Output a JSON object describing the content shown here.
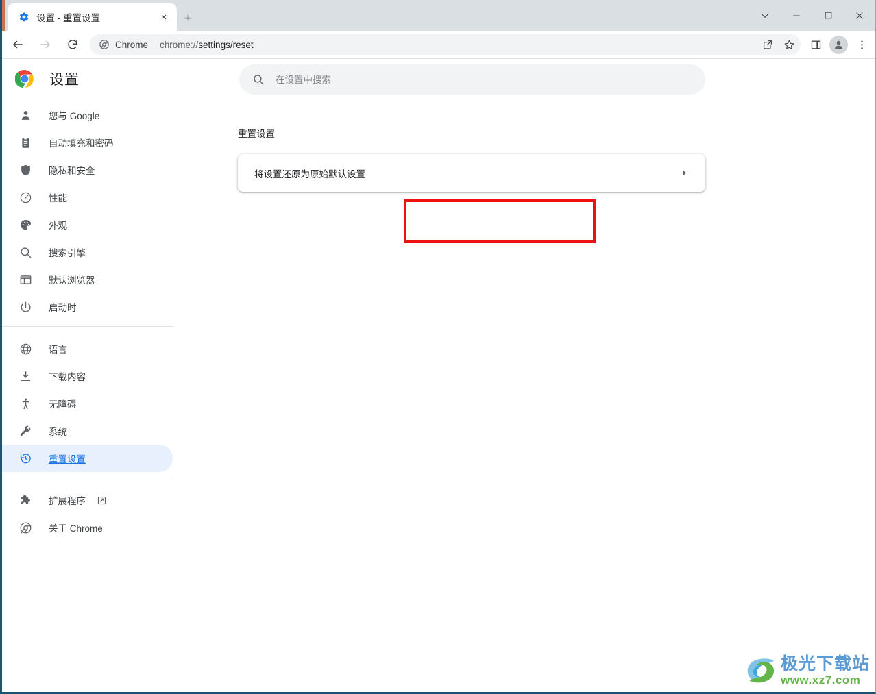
{
  "window": {
    "controls": [
      {
        "name": "tab-search-button",
        "glyph": "chevron-down"
      },
      {
        "name": "minimize-button",
        "glyph": "minimize"
      },
      {
        "name": "maximize-button",
        "glyph": "maximize"
      },
      {
        "name": "close-button",
        "glyph": "close"
      }
    ]
  },
  "tabstrip": {
    "tab_title": "设置 - 重置设置",
    "favicon": "settings-gear-icon",
    "close_label": "×",
    "new_tab_label": "+"
  },
  "toolbar": {
    "back_label": "back-arrow-icon",
    "forward_label": "forward-arrow-icon",
    "reload_label": "reload-icon",
    "omnibox": {
      "chip_icon": "chrome-icon",
      "chip_name": "Chrome",
      "url_prefix": "chrome://",
      "url_bold": "settings/reset",
      "share_icon": "share-icon",
      "bookmark_icon": "star-icon"
    },
    "side_panel_icon": "side-panel-icon",
    "avatar_icon": "profile-avatar-icon",
    "menu_icon": "three-dot-menu-icon"
  },
  "settings": {
    "logo": "chrome-logo",
    "title": "设置",
    "search": {
      "icon": "search-icon",
      "placeholder": "在设置中搜索",
      "value": ""
    },
    "nav_groups": [
      {
        "items": [
          {
            "icon": "person-icon",
            "label": "您与 Google",
            "selected": false,
            "external": false
          },
          {
            "icon": "clipboard-icon",
            "label": "自动填充和密码",
            "selected": false,
            "external": false
          },
          {
            "icon": "shield-icon",
            "label": "隐私和安全",
            "selected": false,
            "external": false
          },
          {
            "icon": "speedometer-icon",
            "label": "性能",
            "selected": false,
            "external": false
          },
          {
            "icon": "palette-icon",
            "label": "外观",
            "selected": false,
            "external": false
          },
          {
            "icon": "magnifier-icon",
            "label": "搜索引擎",
            "selected": false,
            "external": false
          },
          {
            "icon": "browser-icon",
            "label": "默认浏览器",
            "selected": false,
            "external": false
          },
          {
            "icon": "power-icon",
            "label": "启动时",
            "selected": false,
            "external": false
          }
        ]
      },
      {
        "items": [
          {
            "icon": "globe-icon",
            "label": "语言",
            "selected": false,
            "external": false
          },
          {
            "icon": "download-icon",
            "label": "下载内容",
            "selected": false,
            "external": false
          },
          {
            "icon": "accessibility-icon",
            "label": "无障碍",
            "selected": false,
            "external": false
          },
          {
            "icon": "wrench-icon",
            "label": "系统",
            "selected": false,
            "external": false
          },
          {
            "icon": "reset-clock-icon",
            "label": "重置设置",
            "selected": true,
            "external": false
          }
        ]
      },
      {
        "items": [
          {
            "icon": "puzzle-icon",
            "label": "扩展程序",
            "selected": false,
            "external": true
          },
          {
            "icon": "chrome-outline-icon",
            "label": "关于 Chrome",
            "selected": false,
            "external": false
          }
        ]
      }
    ],
    "main": {
      "section_title": "重置设置",
      "reset_card": {
        "label": "将设置还原为原始默认设置",
        "arrow": "chevron-right-icon"
      }
    }
  },
  "annotation": {
    "color": "#ee1111",
    "shape": "rectangle",
    "target": "reset-settings-row"
  },
  "watermark": {
    "title": "极光下载站",
    "url": "www.xz7.com"
  }
}
